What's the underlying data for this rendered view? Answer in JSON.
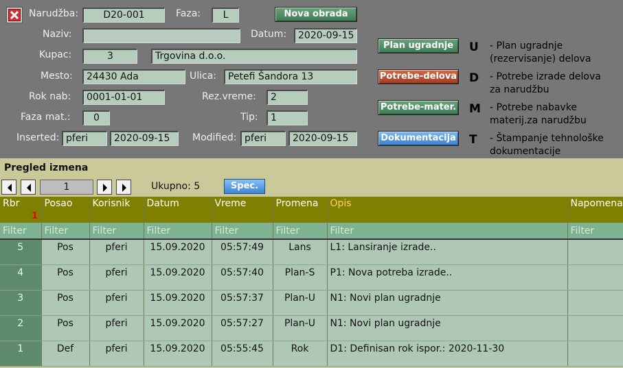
{
  "header": {
    "narudzba_label": "Narudžba:",
    "narudzba_value": "D20-001",
    "faza_label": "Faza:",
    "faza_value": "L",
    "nova_obrada": "Nova obrada",
    "naziv_label": "Naziv:",
    "naziv_value": "",
    "datum_label": "Datum:",
    "datum_value": "2020-09-15",
    "kupac_label": "Kupac:",
    "kupac_id": "3",
    "kupac_name": "Trgovina d.o.o.",
    "mesto_label": "Mesto:",
    "mesto_value": "24430 Ada",
    "ulica_label": "Ulica:",
    "ulica_value": "Petefi Šandora 13",
    "rok_label": "Rok nab:",
    "rok_value": "0001-01-01",
    "rez_label": "Rez.vreme:",
    "rez_value": "2",
    "fazamat_label": "Faza mat.:",
    "fazamat_value": "0",
    "tip_label": "Tip:",
    "tip_value": "1",
    "inserted_label": "Inserted:",
    "inserted_user": "pferi",
    "inserted_date": "2020-09-15",
    "modified_label": "Modified:",
    "modified_user": "pferi",
    "modified_date": "2020-09-15"
  },
  "actions": [
    {
      "label": "Plan ugradnje",
      "letter": "U",
      "desc1": "- Plan ugradnje",
      "desc2": "(rezervisanje) delova",
      "color": "#3d7a53"
    },
    {
      "label": "Potrebe-delova",
      "letter": "D",
      "desc1": "- Potrebe izrade delova",
      "desc2": "za narudžbu",
      "color": "#a13c1f"
    },
    {
      "label": "Potrebe-mater.",
      "letter": "M",
      "desc1": "- Potrebe nabavke",
      "desc2": "materij.za narudžbu",
      "color": "#3d7a53"
    },
    {
      "label": "Dokumentacija",
      "letter": "T",
      "desc1": "- Štampanje tehnološke",
      "desc2": "dokumentacije",
      "color": "#3b7fd0"
    }
  ],
  "changes": {
    "title": "Pregled izmena",
    "page": "1",
    "total": "Ukupno: 5",
    "spec": "Spec.",
    "sort_marker": "1",
    "columns": [
      "Rbr",
      "Posao",
      "Korisnik",
      "Datum",
      "Vreme",
      "Promena",
      "Opis",
      "Napomena"
    ],
    "filter_text": "Filter",
    "rows": [
      [
        "5",
        "Pos",
        "pferi",
        "15.09.2020",
        "05:57:49",
        "Lans",
        "L1: Lansiranje izrade..",
        ""
      ],
      [
        "4",
        "Pos",
        "pferi",
        "15.09.2020",
        "05:57:40",
        "Plan-S",
        "P1: Nova potreba izrade..",
        ""
      ],
      [
        "3",
        "Pos",
        "pferi",
        "15.09.2020",
        "05:57:37",
        "Plan-U",
        "N1: Novi plan ugradnje",
        ""
      ],
      [
        "2",
        "Pos",
        "pferi",
        "15.09.2020",
        "05:57:27",
        "Plan-U",
        "N1: Novi plan ugradnje",
        ""
      ],
      [
        "1",
        "Def",
        "pferi",
        "15.09.2020",
        "05:55:45",
        "Rok",
        "D1: Definisan rok ispor.: 2020-11-30",
        ""
      ]
    ]
  }
}
